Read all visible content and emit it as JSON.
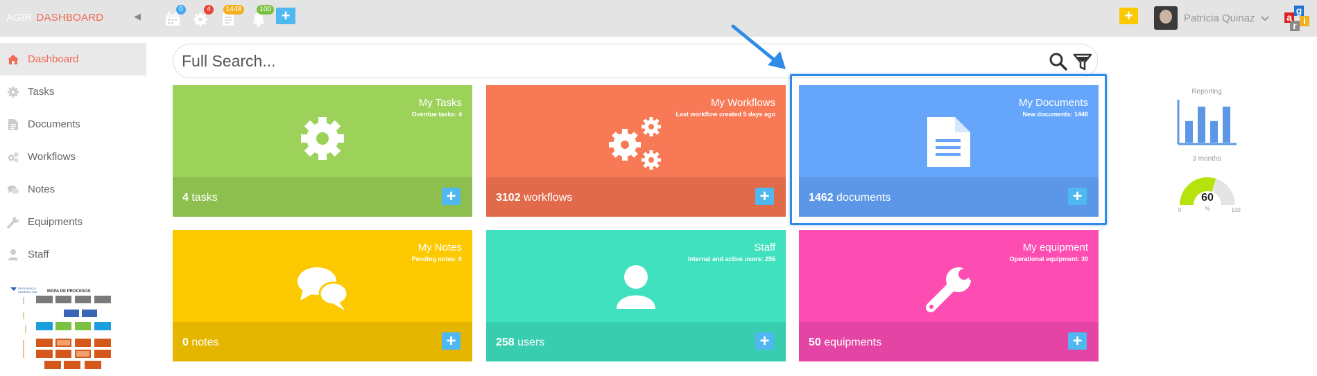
{
  "brand": {
    "name": "AGIR",
    "section": "DASHBOARD"
  },
  "toolbar": {
    "calendar_badge": "0",
    "settings_badge": "4",
    "documents_badge": "1448",
    "notifications_badge": "100",
    "add_label": "+",
    "quick_add_label": "+"
  },
  "user": {
    "name": "Patrícia Quinaz"
  },
  "logo": {
    "letters": [
      "a",
      "g",
      "r",
      "i"
    ],
    "colors": [
      "#e02020",
      "#1f74d0",
      "#8a8a8a",
      "#f2b01e"
    ]
  },
  "sidebar": {
    "items": [
      {
        "label": "Dashboard",
        "icon": "home-icon"
      },
      {
        "label": "Tasks",
        "icon": "gear-icon"
      },
      {
        "label": "Documents",
        "icon": "document-icon"
      },
      {
        "label": "Workflows",
        "icon": "gears-icon"
      },
      {
        "label": "Notes",
        "icon": "chat-bubbles-icon"
      },
      {
        "label": "Equipments",
        "icon": "wrench-icon"
      },
      {
        "label": "Staff",
        "icon": "user-icon"
      }
    ],
    "thumbnail": {
      "title": "MAPA DE PROCESOS",
      "org_line1": "FRIGORIFICO",
      "org_line2": "GENERAL PAZ"
    }
  },
  "search": {
    "placeholder": "Full Search..."
  },
  "tiles": [
    {
      "title": "My Tasks",
      "subtitle": "Overdue tasks: 4",
      "count": "4",
      "unit": "tasks",
      "top_color": "#9cd15a",
      "bottom_color": "#8dbf4e",
      "icon": "gear-icon"
    },
    {
      "title": "My Workflows",
      "subtitle": "Last workflow created 5 days ago",
      "count": "3102",
      "unit": "workflows",
      "top_color": "#f77956",
      "bottom_color": "#e16a4a",
      "icon": "gears-icon"
    },
    {
      "title": "My Documents",
      "subtitle": "New documents: 1446",
      "count": "1462",
      "unit": "documents",
      "top_color": "#65a6fb",
      "bottom_color": "#5b97e6",
      "icon": "document-icon"
    },
    {
      "title": "My Notes",
      "subtitle": "Pending notes: 0",
      "count": "0",
      "unit": "notes",
      "top_color": "#fcc900",
      "bottom_color": "#e4b600",
      "icon": "chat-bubbles-icon"
    },
    {
      "title": "Staff",
      "subtitle": "Internal and active users: 256",
      "count": "258",
      "unit": "users",
      "top_color": "#40e1bf",
      "bottom_color": "#38cdaf",
      "icon": "user-icon"
    },
    {
      "title": "My equipment",
      "subtitle": "Operational equipment: 30",
      "count": "50",
      "unit": "equipments",
      "top_color": "#fd4db2",
      "bottom_color": "#e444a3",
      "icon": "wrench-icon"
    }
  ],
  "reporting": {
    "label": "Reporting",
    "period": "3 months",
    "bars": [
      3,
      5,
      3,
      5
    ]
  },
  "gauge": {
    "value": 60,
    "unit": "%",
    "min": "0",
    "max": "100"
  },
  "colors": {
    "accent": "#f16a55",
    "highlight": "#2f8ce6",
    "add_button": "#4fb8f0",
    "gauge_fill": "#b7e30c"
  }
}
